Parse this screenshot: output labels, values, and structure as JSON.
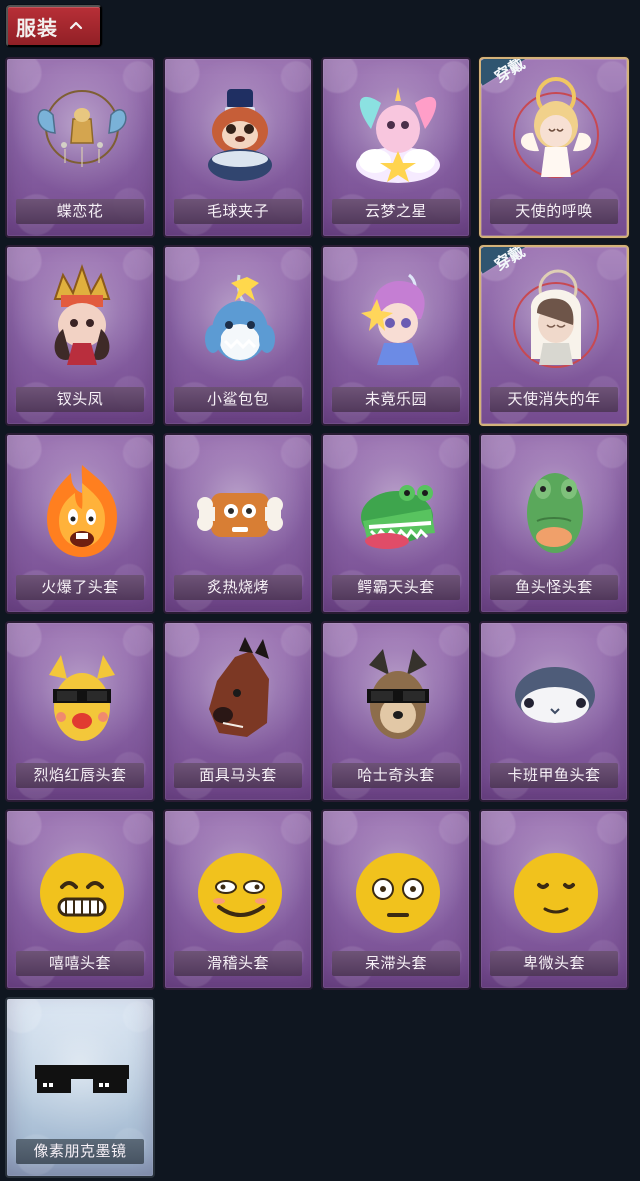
{
  "header": {
    "title": "服装"
  },
  "items": [
    {
      "name": "蝶恋花",
      "icon": "butterfly-headpiece-icon",
      "equipped": false
    },
    {
      "name": "毛球夹子",
      "icon": "raccoon-drum-icon",
      "equipped": false
    },
    {
      "name": "云梦之星",
      "icon": "unicorn-cloud-icon",
      "equipped": false
    },
    {
      "name": "天使的呼唤",
      "icon": "angel-doll-icon",
      "equipped": true,
      "badge": "穿戴"
    },
    {
      "name": "钗头凤",
      "icon": "phoenix-crown-icon",
      "equipped": false
    },
    {
      "name": "小鲨包包",
      "icon": "shark-bag-icon",
      "equipped": false
    },
    {
      "name": "未竟乐园",
      "icon": "fantasy-girl-icon",
      "equipped": false
    },
    {
      "name": "天使消失的年",
      "icon": "veiled-angel-icon",
      "equipped": true,
      "badge": "穿戴"
    },
    {
      "name": "火爆了头套",
      "icon": "fire-head-icon",
      "equipped": false
    },
    {
      "name": "炙热烧烤",
      "icon": "meat-bone-head-icon",
      "equipped": false
    },
    {
      "name": "鳄霸天头套",
      "icon": "crocodile-head-icon",
      "equipped": false
    },
    {
      "name": "鱼头怪头套",
      "icon": "fish-monster-head-icon",
      "equipped": false
    },
    {
      "name": "烈焰红唇头套",
      "icon": "pika-mask-icon",
      "equipped": false
    },
    {
      "name": "面具马头套",
      "icon": "horse-mask-icon",
      "equipped": false
    },
    {
      "name": "哈士奇头套",
      "icon": "husky-mask-icon",
      "equipped": false
    },
    {
      "name": "卡班甲鱼头套",
      "icon": "ray-fish-head-icon",
      "equipped": false
    },
    {
      "name": "嘻嘻头套",
      "icon": "grin-emoji-head-icon",
      "equipped": false
    },
    {
      "name": "滑稽头套",
      "icon": "funny-emoji-head-icon",
      "equipped": false
    },
    {
      "name": "呆滞头套",
      "icon": "dazed-emoji-head-icon",
      "equipped": false
    },
    {
      "name": "卑微头套",
      "icon": "humble-emoji-head-icon",
      "equipped": false
    },
    {
      "name": "像素朋克墨镜",
      "icon": "pixel-sunglasses-icon",
      "equipped": false,
      "variant": "blue"
    }
  ]
}
